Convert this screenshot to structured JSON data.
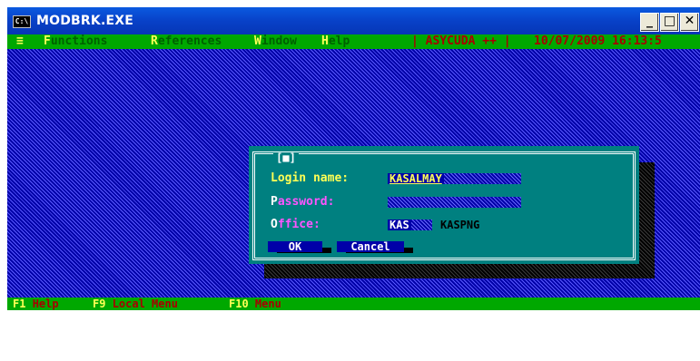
{
  "window": {
    "title": "MODBRK.EXE",
    "icon_label": "C:\\",
    "controls": {
      "minimize": "_",
      "maximize": "□",
      "close": "✕"
    }
  },
  "menubar": {
    "system_menu": "≡",
    "items": [
      {
        "hot": "F",
        "rest": "unctions"
      },
      {
        "hot": "R",
        "rest": "eferences"
      },
      {
        "hot": "W",
        "rest": "indow"
      },
      {
        "hot": "H",
        "rest": "elp"
      }
    ],
    "product": "| ASYCUDA ++ |",
    "datetime": "10/07/2009 16:13:5"
  },
  "dialog": {
    "close_marker": "[■]",
    "login_label": "Login name:",
    "login_value": "KASALMAY",
    "password_hot": "P",
    "password_rest": "assword:",
    "office_hot": "O",
    "office_rest": "ffice:",
    "office_code": "KAS",
    "office_name": "KASPNG",
    "ok_label": " OK ",
    "cancel_label": "Cancel"
  },
  "statusbar": {
    "items": [
      {
        "key": "F1",
        "label": "Help"
      },
      {
        "key": "F9",
        "label": "Local Menu"
      },
      {
        "key": "F10",
        "label": "Menu"
      }
    ]
  },
  "colors": {
    "desktop": "#0000a8",
    "menubar": "#00a800",
    "dialog": "#008080",
    "hotkey": "#ffff55",
    "label": "#ff55ff"
  }
}
